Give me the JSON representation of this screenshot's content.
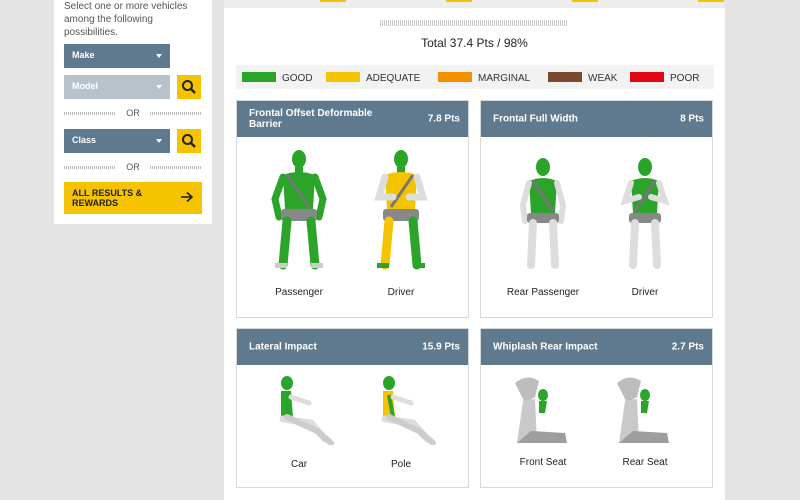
{
  "sidebar": {
    "intro": "Select one or more vehicles among the following possibilities.",
    "make_label": "Make",
    "model_label": "Model",
    "class_label": "Class",
    "or_label": "OR",
    "results_label_1": "ALL RESULTS &",
    "results_label_2": "REWARDS",
    "arrow": "→"
  },
  "main": {
    "total": "Total 37.4 Pts / 98%",
    "legend": [
      {
        "label": "GOOD",
        "color": "#2aa52a"
      },
      {
        "label": "ADEQUATE",
        "color": "#f5c300"
      },
      {
        "label": "MARGINAL",
        "color": "#f39200"
      },
      {
        "label": "WEAK",
        "color": "#7b4a2e"
      },
      {
        "label": "POOR",
        "color": "#e30613"
      }
    ],
    "cards": [
      {
        "title": "Frontal Offset Deformable Barrier",
        "points": "7.8 Pts",
        "figures": [
          "Passenger",
          "Driver"
        ]
      },
      {
        "title": "Frontal Full Width",
        "points": "8 Pts",
        "figures": [
          "Rear Passenger",
          "Driver"
        ]
      },
      {
        "title": "Lateral Impact",
        "points": "15.9 Pts",
        "figures": [
          "Car",
          "Pole"
        ]
      },
      {
        "title": "Whiplash Rear Impact",
        "points": "2.7 Pts",
        "figures": [
          "Front Seat",
          "Rear Seat"
        ]
      }
    ]
  },
  "colors": {
    "accent": "#f5c300",
    "header": "#5f7a8e",
    "good": "#2aa52a",
    "adequate": "#f5c300"
  }
}
